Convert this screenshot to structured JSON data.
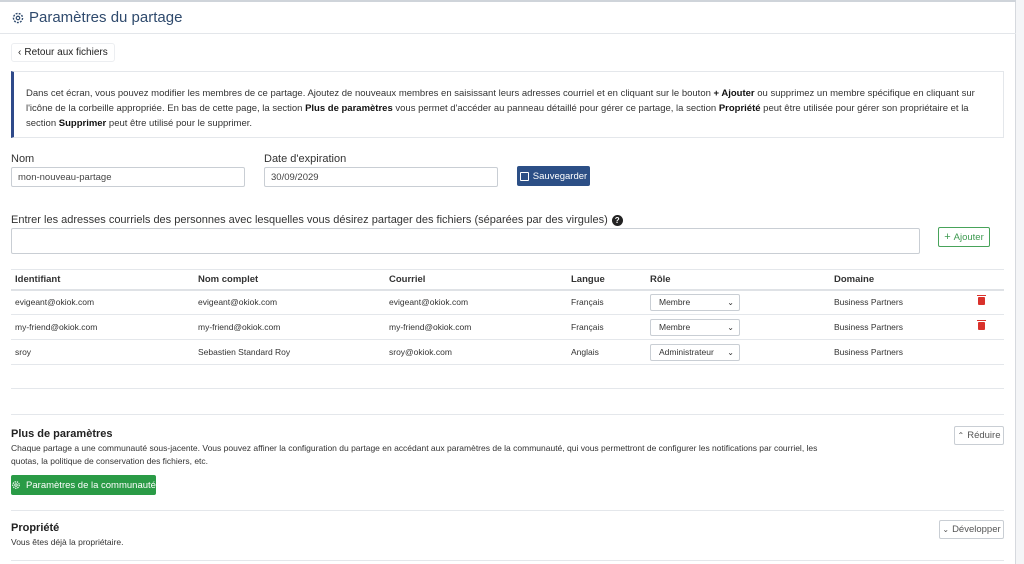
{
  "header": {
    "title": "Paramètres du partage",
    "icon": "gear-icon"
  },
  "back_button": {
    "label": "Retour aux fichiers"
  },
  "info": {
    "part1": "Dans cet écran, vous pouvez modifier les membres de ce partage. Ajoutez de nouveaux membres en saisissant leurs adresses courriel et en cliquant sur le bouton ",
    "b1": "+ Ajouter",
    "part2": " ou supprimez un membre spécifique en cliquant sur l'icône de la corbeille appropriée. En bas de cette page, la section ",
    "b2": "Plus de paramètres",
    "part3": " vous permet d'accéder au panneau détaillé pour gérer ce partage, la section ",
    "b3": "Propriété",
    "part4": " peut être utilisée pour gérer son propriétaire et la section ",
    "b4": "Supprimer",
    "part5": " peut être utilisé pour le supprimer."
  },
  "form": {
    "name_label": "Nom",
    "name_value": "mon-nouveau-partage",
    "expiry_label": "Date d'expiration",
    "expiry_value": "30/09/2029",
    "save_label": "Sauvegarder"
  },
  "emails": {
    "label": "Entrer les adresses courriels des personnes avec lesquelles vous désirez partager des fichiers (séparées par des virgules)",
    "add_label": "Ajouter"
  },
  "table": {
    "headers": [
      "Identifiant",
      "Nom complet",
      "Courriel",
      "Langue",
      "Rôle",
      "Domaine"
    ],
    "rows": [
      {
        "id": "evigeant@okiok.com",
        "name": "evigeant@okiok.com",
        "email": "evigeant@okiok.com",
        "lang": "Français",
        "role": "Membre",
        "domain": "Business Partners"
      },
      {
        "id": "my-friend@okiok.com",
        "name": "my-friend@okiok.com",
        "email": "my-friend@okiok.com",
        "lang": "Français",
        "role": "Membre",
        "domain": "Business Partners"
      },
      {
        "id": "sroy",
        "name": "Sebastien Standard Roy",
        "email": "sroy@okiok.com",
        "lang": "Anglais",
        "role": "Administrateur",
        "domain": "Business Partners"
      }
    ]
  },
  "more_settings": {
    "title": "Plus de paramètres",
    "text": "Chaque partage a une communauté sous-jacente. Vous pouvez affiner la configuration du partage en accédant aux paramètres de la communauté, qui vous permettront de configurer les notifications par courriel, les quotas, la politique de conservation des fichiers, etc.",
    "collapse_label": "Réduire",
    "community_button": "Paramètres de la communauté"
  },
  "ownership": {
    "title": "Propriété",
    "text": "Vous êtes déjà la propriétaire.",
    "expand_label": "Développer"
  },
  "colors": {
    "primary": "#2c4f86",
    "success": "#2a9b46",
    "danger": "#d9312b",
    "title": "#2f4a6d"
  }
}
